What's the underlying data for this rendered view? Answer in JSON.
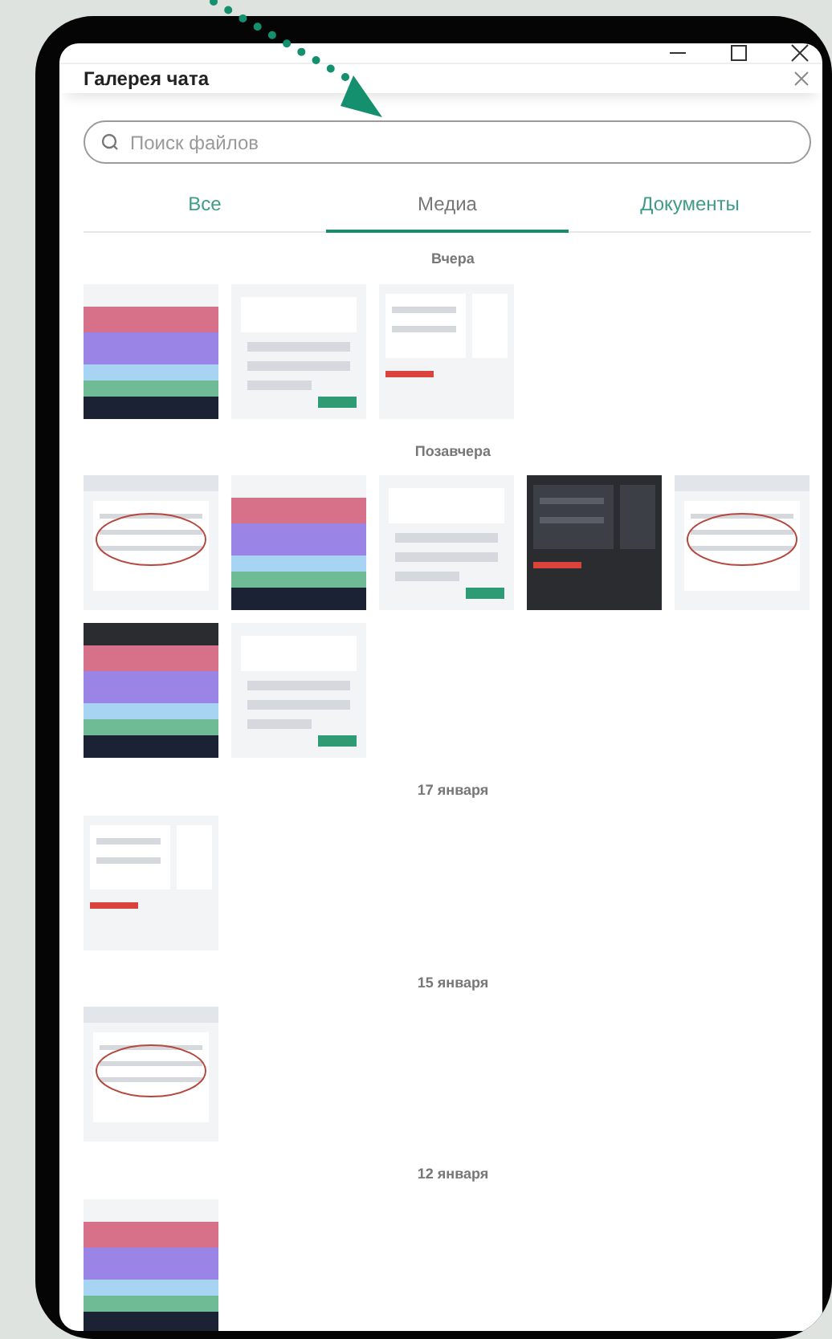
{
  "window": {
    "controls": [
      {
        "kind": "minimize"
      },
      {
        "kind": "maximize"
      },
      {
        "kind": "close"
      }
    ]
  },
  "header": {
    "title": "Галерея чата"
  },
  "search": {
    "placeholder": "Поиск файлов"
  },
  "tabs": [
    {
      "label": "Все",
      "selected": false
    },
    {
      "label": "Медиа",
      "selected": true
    },
    {
      "label": "Документы",
      "selected": false
    }
  ],
  "groups": [
    {
      "date": "Вчера"
    },
    {
      "date": "Позавчера"
    },
    {
      "date": "17 января"
    },
    {
      "date": "15 января"
    },
    {
      "date": "12 января"
    }
  ]
}
